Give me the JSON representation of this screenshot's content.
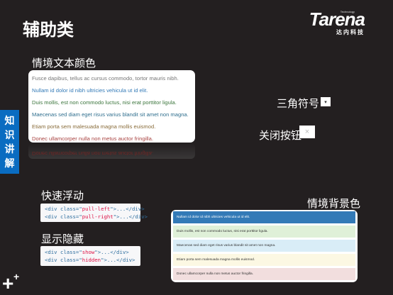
{
  "title": "辅助类",
  "logo": {
    "tech": "Technology",
    "name": "Tarena",
    "cn": "达内科技"
  },
  "sidebar_label": "知识讲解",
  "text_colors": {
    "heading": "情境文本颜色",
    "lines": [
      {
        "text": "Fusce dapibus, tellus ac cursus commodo, tortor mauris nibh.",
        "color": "#777777"
      },
      {
        "text": "Nullam id dolor id nibh ultricies vehicula ut id elit.",
        "color": "#337ab7"
      },
      {
        "text": "Duis mollis, est non commodo luctus, nisi erat porttitor ligula.",
        "color": "#3c763d"
      },
      {
        "text": "Maecenas sed diam eget risus varius blandit sit amet non magna.",
        "color": "#31708f"
      },
      {
        "text": "Etiam porta sem malesuada magna mollis euismod.",
        "color": "#8a6d3b"
      },
      {
        "text": "Donec ullamcorper nulla non metus auctor fringilla.",
        "color": "#a94442"
      }
    ]
  },
  "caret": {
    "label": "三角符号",
    "glyph": "▾"
  },
  "close": {
    "label": "关闭按钮",
    "glyph": "×"
  },
  "float": {
    "heading": "快速浮动",
    "lines": [
      {
        "pre": "<div class=\"",
        "cls": "pull-left",
        "post": "\">...</div>"
      },
      {
        "pre": "<div class=\"",
        "cls": "pull-right",
        "post": "\">...</div>"
      }
    ]
  },
  "showhide": {
    "heading": "显示隐藏",
    "lines": [
      {
        "pre": "<div class=\"",
        "cls": "show",
        "post": "\">...</div>"
      },
      {
        "pre": "<div class=\"",
        "cls": "hidden",
        "post": "\">...</div>"
      }
    ]
  },
  "bg_colors": {
    "heading": "情境背景色",
    "rows": [
      {
        "text": "Nullam id dolor id nibh ultricies vehicula ut id elit.",
        "bg": "#337ab7",
        "fg": "#ffffff"
      },
      {
        "text": "Duis mollis, est non commodo luctus, nisi erat porttitor ligula.",
        "bg": "#dff0d8",
        "fg": "#333333"
      },
      {
        "text": "Maecenas sed diam eget risus varius blandit sit amet non magna.",
        "bg": "#d9edf7",
        "fg": "#333333"
      },
      {
        "text": "Etiam porta sem malesuada magna mollis euismod.",
        "bg": "#fcf8e3",
        "fg": "#333333"
      },
      {
        "text": "Donec ullamcorper nulla non metus auctor fringilla.",
        "bg": "#f2dede",
        "fg": "#333333"
      }
    ]
  },
  "plus_glyph": "+"
}
